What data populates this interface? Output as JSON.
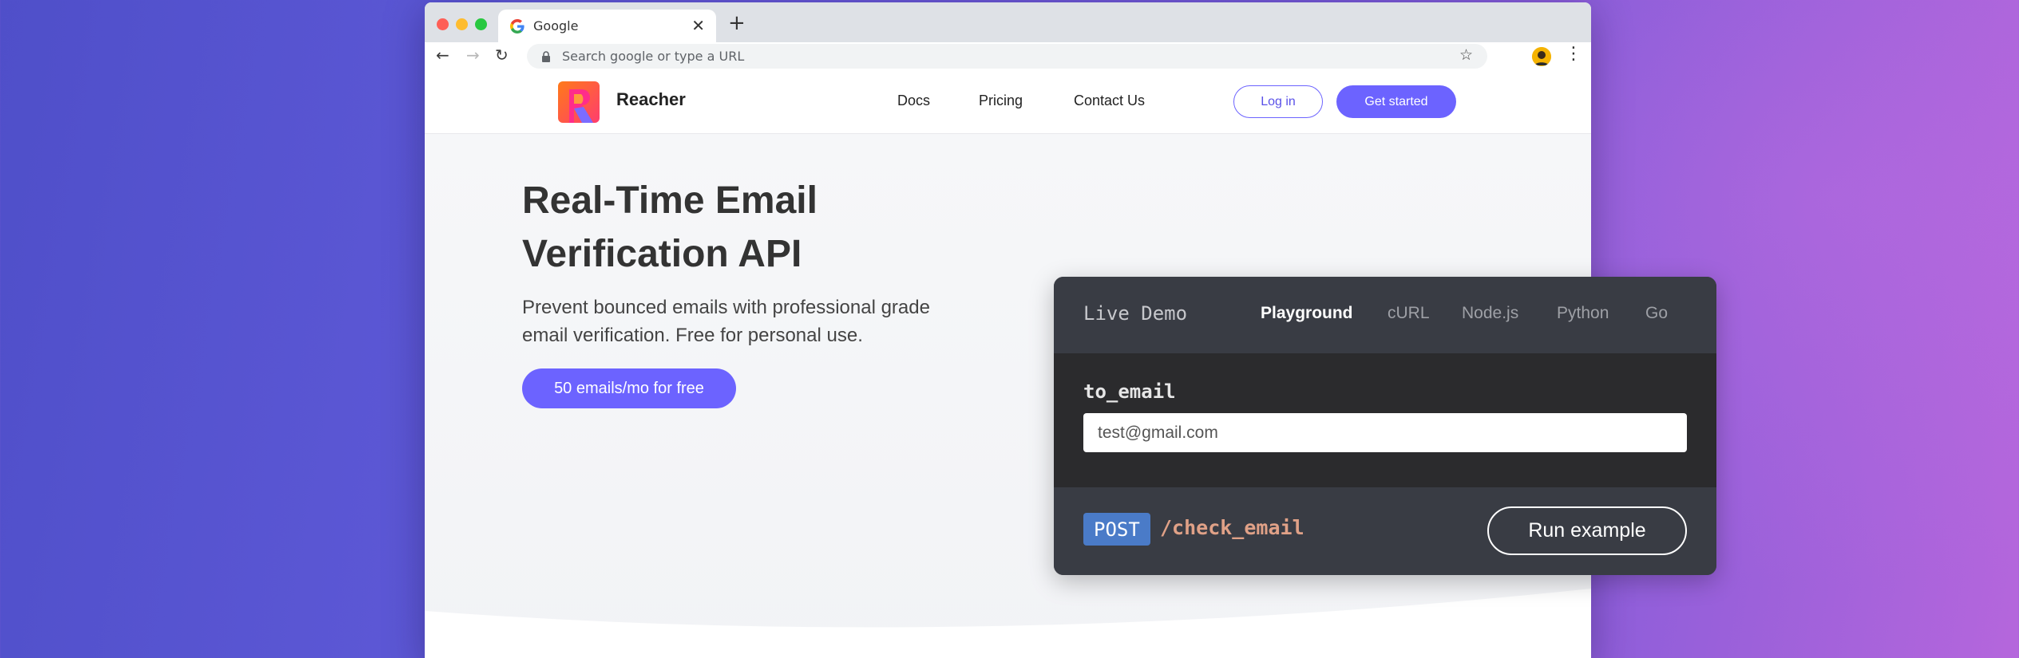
{
  "browser": {
    "tab_title": "Google",
    "tab_close": "✕",
    "new_tab": "+",
    "omnibox_placeholder": "Search google or type a URL",
    "back": "←",
    "forward": "→",
    "reload": "↻",
    "star": "☆",
    "menu": "⋮"
  },
  "site": {
    "brand": "Reacher",
    "nav": {
      "docs": "Docs",
      "pricing": "Pricing",
      "contact": "Contact Us"
    },
    "login_label": "Log in",
    "get_started_label": "Get started",
    "accent": "#6c63ff"
  },
  "hero": {
    "title": "Real-Time Email Verification API",
    "subtitle": "Prevent bounced emails with professional grade email verification. Free for personal use.",
    "cta_label": "50 emails/mo for free"
  },
  "demo": {
    "title": "Live Demo",
    "tabs": [
      "Playground",
      "cURL",
      "Node.js",
      "Python",
      "Go"
    ],
    "active_tab": "Playground",
    "field_label": "to_email",
    "field_value": "test@gmail.com",
    "method": "POST",
    "endpoint": "/check_email",
    "run_label": "Run example"
  }
}
